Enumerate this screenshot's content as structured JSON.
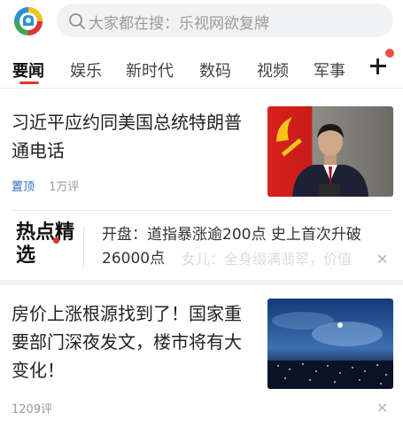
{
  "search": {
    "placeholder": "大家都在搜：乐视网欲复牌"
  },
  "tabs": [
    {
      "label": "要闻"
    },
    {
      "label": "娱乐"
    },
    {
      "label": "新时代"
    },
    {
      "label": "数码"
    },
    {
      "label": "视频"
    },
    {
      "label": "军事"
    }
  ],
  "news1": {
    "title": "习近平应约同美国总统特朗普通电话",
    "tag": "置顶",
    "comments": "1万评"
  },
  "hot": {
    "label": "热点精选",
    "text": "开盘：道指暴涨逾200点 史上首次升破26000点",
    "faded": "女儿：全身缀满翡翠，价值"
  },
  "news2": {
    "title": "房价上涨根源找到了！国家重要部门深夜发文，楼市将有大变化！",
    "comments": "1209评"
  },
  "icons": {
    "logo": "news-app-logo-icon",
    "search": "search-icon",
    "plus": "add-channel-icon",
    "close": "close-icon"
  },
  "colors": {
    "accent": "#e23232",
    "top_tag": "#2b6fc2",
    "search_bg": "#f1f2f4"
  }
}
